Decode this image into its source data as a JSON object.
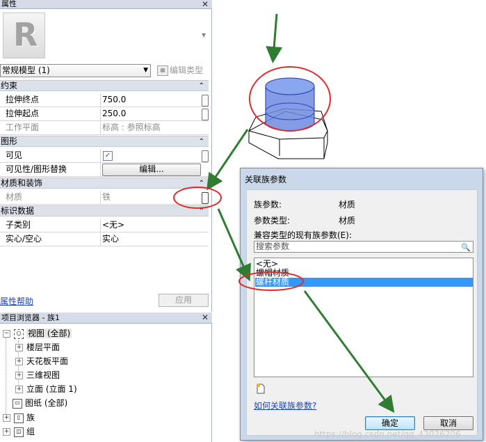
{
  "properties": {
    "title": "属性",
    "type_selector": "常规模型 (1)",
    "edit_type": "编辑类型",
    "categories": {
      "constraints": "约束",
      "graphics": "图形",
      "materials": "材质和装饰",
      "identity": "标识数据"
    },
    "rows": {
      "extrusion_end": {
        "label": "拉伸终点",
        "value": "750.0"
      },
      "extrusion_start": {
        "label": "拉伸起点",
        "value": "250.0"
      },
      "work_plane": {
        "label": "工作平面",
        "value": "标高 : 参照标高"
      },
      "visible": {
        "label": "可见",
        "value": "✓"
      },
      "visibility_override": {
        "label": "可见性/图形替换",
        "value": "编辑..."
      },
      "material": {
        "label": "材质",
        "value": "铁"
      },
      "subcategory": {
        "label": "子类别",
        "value": "<无>"
      },
      "solid_void": {
        "label": "实心/空心",
        "value": "实心"
      }
    },
    "help_link": "属性帮助",
    "apply_button": "应用"
  },
  "project_browser": {
    "title": "项目浏览器 - 族1",
    "items": {
      "views": "视图 (全部)",
      "floor_plans": "楼层平面",
      "ceiling_plans": "天花板平面",
      "views_3d": "三维视图",
      "elevations": "立面 (立面 1)",
      "sheets": "图纸 (全部)",
      "families": "族",
      "groups": "组"
    }
  },
  "dialog": {
    "title": "关联族参数",
    "family_param_label": "族参数:",
    "family_param_value": "材质",
    "param_type_label": "参数类型:",
    "param_type_value": "材质",
    "compatible_label": "兼容类型的现有族参数(E):",
    "search_placeholder": "搜索参数",
    "params": [
      "<无>",
      "螺帽材质",
      "螺杆材质"
    ],
    "selected_index": 2,
    "help_link": "如何关联族参数?",
    "ok": "确定",
    "cancel": "取消"
  },
  "watermark": "https://blog.csdn.net/qq_43026206"
}
